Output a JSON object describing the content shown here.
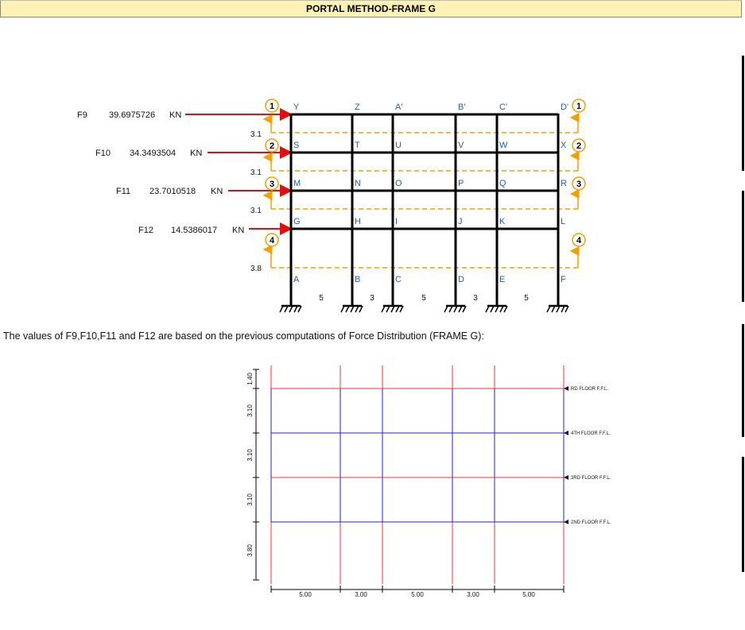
{
  "title": "PORTAL METHOD-FRAME G",
  "forces": [
    {
      "label": "F9",
      "value": "39.6975726",
      "unit": "KN"
    },
    {
      "label": "F10",
      "value": "34.3493504",
      "unit": "KN"
    },
    {
      "label": "F11",
      "value": "23.7010518",
      "unit": "KN"
    },
    {
      "label": "F12",
      "value": "14.5386017",
      "unit": "KN"
    }
  ],
  "frame": {
    "story_heights": [
      "3.1",
      "3.1",
      "3.1",
      "3.8"
    ],
    "bay_widths": [
      "5",
      "3",
      "5",
      "3",
      "5"
    ],
    "level_markers": [
      "1",
      "2",
      "3",
      "4"
    ],
    "node_rows": [
      [
        "Y",
        "Z",
        "A'",
        "B'",
        "C'",
        "D'"
      ],
      [
        "S",
        "T",
        "U",
        "V",
        "W",
        "X"
      ],
      [
        "M",
        "N",
        "O",
        "P",
        "Q",
        "R"
      ],
      [
        "G",
        "H",
        "I",
        "J",
        "K",
        "L"
      ],
      [
        "A",
        "B",
        "C",
        "D",
        "E",
        "F"
      ]
    ]
  },
  "note": "The values of F9,F10,F11 and F12 are based on the previous computations of Force Distribution (FRAME G):",
  "cad": {
    "vertical_dims": [
      "1.40",
      "3.10",
      "3.10",
      "3.10",
      "3.80"
    ],
    "horizontal_dims": [
      "5.00",
      "3.00",
      "5.00",
      "3.00",
      "5.00"
    ],
    "floor_labels": [
      "RD FLOOR F.F.L.",
      "4TH FLOOR F.F.L.",
      "3RD FLOOR F.F.L.",
      "2ND FLOOR F.F.L."
    ]
  },
  "colors": {
    "force_arrow": "#e01010",
    "reaction_arrow": "#f0a000",
    "node_label": "#1f5fbf",
    "cad_red": "#ff3030",
    "cad_blue": "#2020d0"
  }
}
